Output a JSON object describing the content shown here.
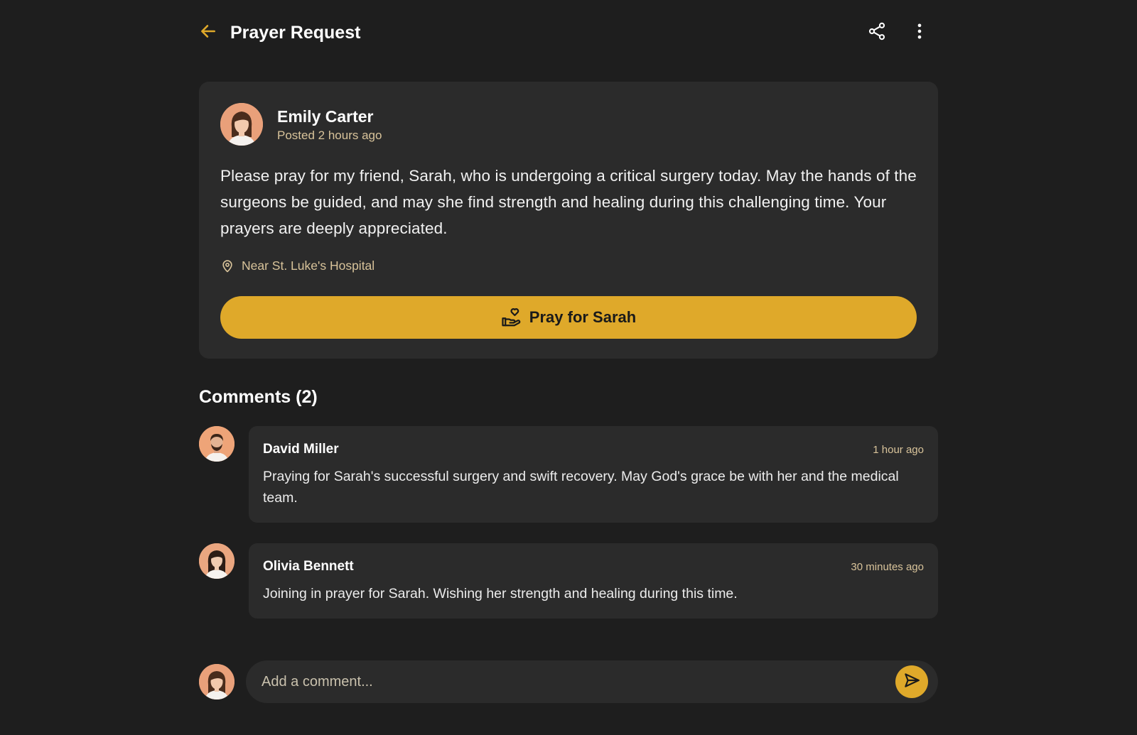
{
  "header": {
    "title": "Prayer Request",
    "back_icon": "arrow-left-icon",
    "share_icon": "share-icon",
    "more_icon": "more-vertical-icon"
  },
  "post": {
    "author": "Emily Carter",
    "time": "Posted 2 hours ago",
    "body": "Please pray for my friend, Sarah, who is undergoing a critical surgery today. May the hands of the surgeons be guided, and may she find strength and healing during this challenging time. Your prayers are deeply appreciated.",
    "location": "Near St. Luke's Hospital",
    "pray_button": "Pray for Sarah"
  },
  "comments": {
    "title": "Comments (2)",
    "items": [
      {
        "author": "David Miller",
        "time": "1 hour ago",
        "text": "Praying for Sarah's successful surgery and swift recovery. May God's grace be with her and the medical team."
      },
      {
        "author": "Olivia Bennett",
        "time": "30 minutes ago",
        "text": "Joining in prayer for Sarah. Wishing her strength and healing during this time."
      }
    ]
  },
  "composer": {
    "placeholder": "Add a comment...",
    "send_icon": "send-icon"
  },
  "colors": {
    "background": "#1e1e1e",
    "card": "#2b2b2b",
    "accent": "#dfa92a",
    "muted_text": "#d8c39a"
  }
}
